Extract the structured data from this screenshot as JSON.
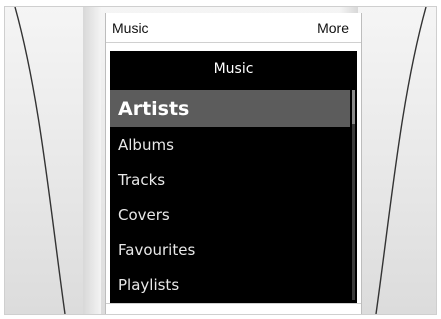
{
  "topbar": {
    "left_label": "Music",
    "right_label": "More"
  },
  "panel": {
    "title": "Music"
  },
  "menu": {
    "items": [
      {
        "label": "Artists",
        "selected": true
      },
      {
        "label": "Albums",
        "selected": false
      },
      {
        "label": "Tracks",
        "selected": false
      },
      {
        "label": "Covers",
        "selected": false
      },
      {
        "label": "Favourites",
        "selected": false
      },
      {
        "label": "Playlists",
        "selected": false
      }
    ]
  },
  "colors": {
    "panel_bg": "#000000",
    "selected_bg": "#5c5c5c"
  }
}
